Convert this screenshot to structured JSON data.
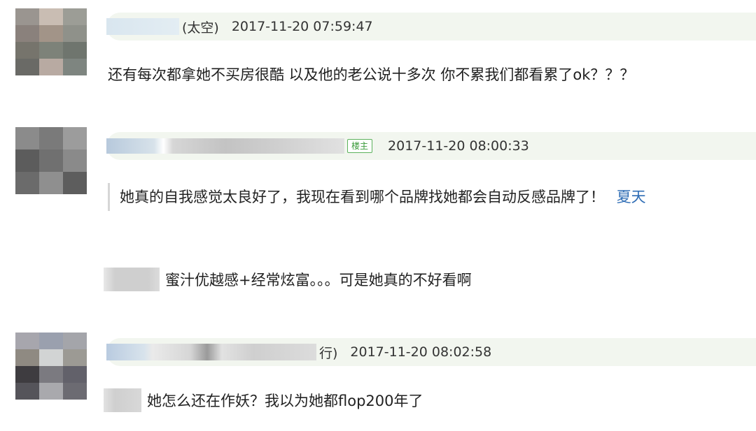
{
  "posts": [
    {
      "name_suffix": "(太空)",
      "time": "2017-11-20 07:59:47",
      "content": "还有每次都拿她不买房很酷 以及他的老公说十多次 你不累我们都看累了ok？？？"
    },
    {
      "badge": "楼主",
      "time": "2017-11-20 08:00:33",
      "quote_text": "她真的自我感觉太良好了，我现在看到哪个品牌找她都会自动反感品牌了！",
      "quote_link": "夏天",
      "reply_text": "蜜汁优越感+经常炫富。。。可是她真的不好看啊"
    },
    {
      "name_suffix": "行)",
      "time": "2017-11-20 08:02:58",
      "content": "她怎么还在作妖？我以为她都flop200年了"
    }
  ],
  "colors": {
    "header_bg": "#f2f6ef",
    "link": "#2f6db5",
    "badge_green": "#3a9a3a"
  }
}
